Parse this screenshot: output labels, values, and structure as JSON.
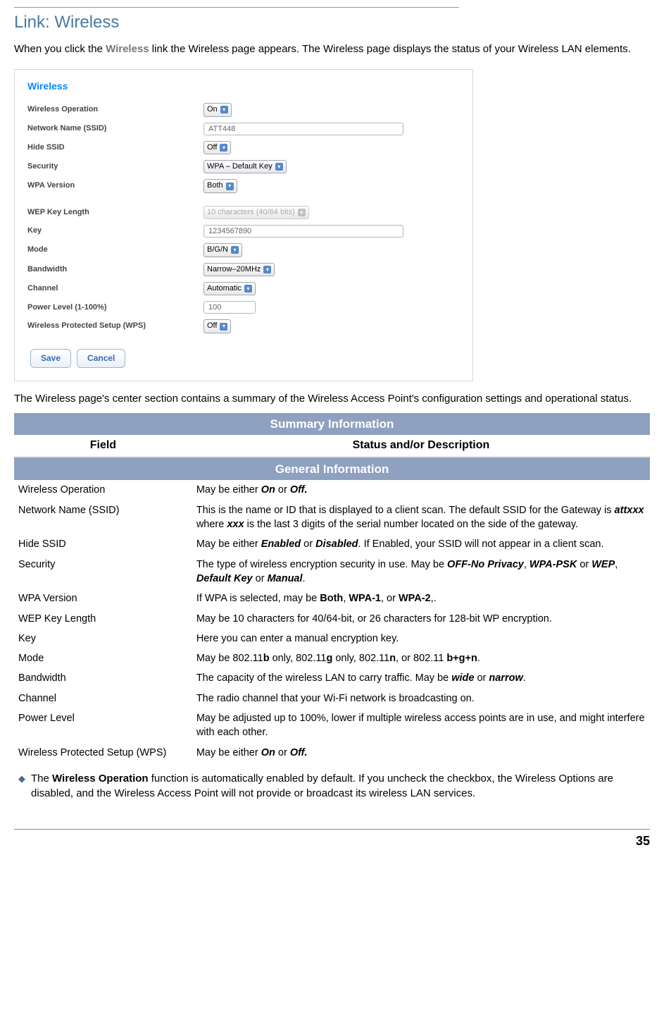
{
  "title": "Link: Wireless",
  "intro": {
    "pre": "When you click the ",
    "bold": "Wireless",
    "post": " link the Wireless page appears. The Wireless page displays the status of your Wireless LAN elements."
  },
  "panel": {
    "heading": "Wireless",
    "rows": {
      "op_label": "Wireless Operation",
      "op_value": "On",
      "ssid_label": "Network Name (SSID)",
      "ssid_value": "ATT448",
      "hide_label": "Hide SSID",
      "hide_value": "Off",
      "sec_label": "Security",
      "sec_value": "WPA – Default Key",
      "wpa_label": "WPA Version",
      "wpa_value": "Both",
      "wep_label": "WEP Key Length",
      "wep_value": "10 characters (40/64 bits)",
      "key_label": "Key",
      "key_value": "1234567890",
      "mode_label": "Mode",
      "mode_value": "B/G/N",
      "bw_label": "Bandwidth",
      "bw_value": "Narrow–20MHz",
      "chan_label": "Channel",
      "chan_value": "Automatic",
      "pow_label": "Power Level (1-100%)",
      "pow_value": "100",
      "wps_label": "Wireless Protected Setup (WPS)",
      "wps_value": "Off"
    },
    "save": "Save",
    "cancel": "Cancel"
  },
  "mid_text": "The Wireless page's center section contains a summary of the Wireless Access Point's configuration settings and operational status.",
  "table": {
    "title": "Summary Information",
    "col1": "Field",
    "col2": "Status and/or Description",
    "section": "General Information",
    "rows": [
      {
        "f": "Wireless Operation",
        "html": "May be either <b><i>On</i></b> or <b><i>Off.</i></b>"
      },
      {
        "f": "Network Name (SSID)",
        "html": "This is the name or ID that is displayed to a client scan. The default SSID for the Gateway is <b><i>attxxx</i></b> where <b><i>xxx</i></b> is the last 3 digits of the serial number located on the side of the gateway."
      },
      {
        "f": "Hide SSID",
        "html": "May be either <b><i>Enabled</i></b> or <b><i>Disabled</i></b>. If Enabled, your SSID will not appear in a client scan."
      },
      {
        "f": "Security",
        "html": "The type of wireless encryption security in use. May be <b><i>OFF-No Privacy</i></b>, <b><i>WPA-PSK</i></b> or <b><i>WEP</i></b>, <b><i>Default Key</i></b> or <b><i>Manual</i></b>."
      },
      {
        "f": "WPA Version",
        "html": "If WPA is selected, may be <b>Both</b>, <b>WPA-1</b>, or <b>WPA-2</b>,."
      },
      {
        "f": "WEP Key Length",
        "html": "May be 10 characters for 40/64-bit, or 26 characters for 128-bit WP encryption."
      },
      {
        "f": "Key",
        "html": "Here you can enter a manual encryption key."
      },
      {
        "f": "Mode",
        "html": "May be 802.11<b>b</b> only, 802.11<b>g</b> only, 802.11<b>n</b>, or 802.11 <b>b+g+n</b>."
      },
      {
        "f": "Bandwidth",
        "html": "The capacity of the wireless LAN to carry traffic. May be <b><i>wide</i></b> or <b><i>narrow</i></b>."
      },
      {
        "f": "Channel",
        "html": "The radio channel that your Wi-Fi network is broadcasting on."
      },
      {
        "f": "Power Level",
        "html": "May be adjusted up to 100%, lower if multiple wireless access points are in use, and might interfere with each other."
      },
      {
        "f": "Wireless Protected Setup (WPS)",
        "html": "May be either <b><i>On</i></b> or <b><i>Off.</i></b>"
      }
    ]
  },
  "note": {
    "html": "The <b>Wireless Operation</b> function is automatically enabled by default. If you uncheck the checkbox, the Wireless Options are disabled, and the Wireless Access Point will not provide or broadcast its wireless LAN services."
  },
  "page_number": "35"
}
